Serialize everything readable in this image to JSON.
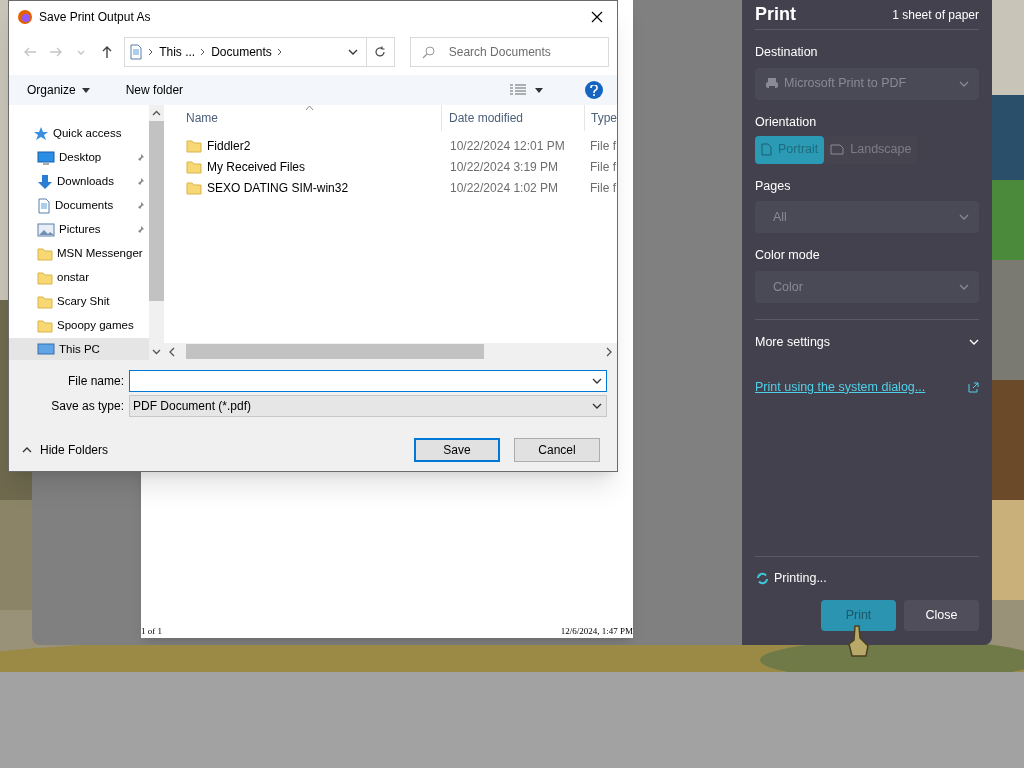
{
  "save_dialog": {
    "title": "Save Print Output As",
    "breadcrumb": [
      "This ...",
      "Documents"
    ],
    "search": {
      "placeholder": "Search Documents"
    },
    "toolbar": [
      {
        "label": "Organize",
        "menu": true
      },
      {
        "label": "New folder",
        "menu": false
      }
    ],
    "nav_pane": [
      {
        "label": "Quick access",
        "kind": "quick-access",
        "pinned": false,
        "selected": false
      },
      {
        "label": "Desktop",
        "kind": "desktop",
        "pinned": true,
        "selected": false
      },
      {
        "label": "Downloads",
        "kind": "downloads",
        "pinned": true,
        "selected": false
      },
      {
        "label": "Documents",
        "kind": "documents",
        "pinned": true,
        "selected": false
      },
      {
        "label": "Pictures",
        "kind": "pictures",
        "pinned": true,
        "selected": false
      },
      {
        "label": "MSN Messenger",
        "kind": "folder",
        "pinned": false,
        "selected": false
      },
      {
        "label": "onstar",
        "kind": "folder",
        "pinned": false,
        "selected": false
      },
      {
        "label": "Scary Shit",
        "kind": "folder",
        "pinned": false,
        "selected": false
      },
      {
        "label": "Spoopy games",
        "kind": "folder",
        "pinned": false,
        "selected": false
      },
      {
        "label": "This PC",
        "kind": "pc",
        "pinned": false,
        "selected": true
      }
    ],
    "columns": [
      "Name",
      "Date modified",
      "Type"
    ],
    "rows": [
      {
        "name": "Fiddler2",
        "date": "10/22/2024 12:01 PM",
        "type": "File f"
      },
      {
        "name": "My Received Files",
        "date": "10/22/2024 3:19 PM",
        "type": "File f"
      },
      {
        "name": "SEXO DATING SIM-win32",
        "date": "10/22/2024 1:02 PM",
        "type": "File f"
      }
    ],
    "file_name": {
      "label": "File name:"
    },
    "save_as_type": {
      "label": "Save as type:",
      "value": "PDF Document (*.pdf)"
    },
    "hide_folders": "Hide Folders",
    "buttons": [
      {
        "label": "Save",
        "default": true
      },
      {
        "label": "Cancel",
        "default": false
      }
    ]
  },
  "preview": {
    "page_footer_left": "1 of 1",
    "page_footer_right": "12/6/2024, 1:47 PM"
  },
  "print_panel": {
    "title": "Print",
    "sheets": "1 sheet of paper",
    "destination": {
      "label": "Destination",
      "value": "Microsoft Print to PDF",
      "disabled": true
    },
    "orientation": {
      "label": "Orientation",
      "options": [
        {
          "label": "Portrait",
          "selected": true
        },
        {
          "label": "Landscape",
          "selected": false
        }
      ],
      "disabled": true
    },
    "pages": {
      "label": "Pages",
      "value": "All",
      "disabled": true
    },
    "color_mode": {
      "label": "Color mode",
      "value": "Color",
      "disabled": true
    },
    "more_settings": {
      "label": "More settings",
      "expanded": false
    },
    "system_dialog_link": "Print using the system dialog...",
    "status": "Printing...",
    "buttons": [
      {
        "label": "Print",
        "kind": "primary",
        "disabled": true
      },
      {
        "label": "Close",
        "kind": "secondary",
        "disabled": false
      }
    ]
  }
}
